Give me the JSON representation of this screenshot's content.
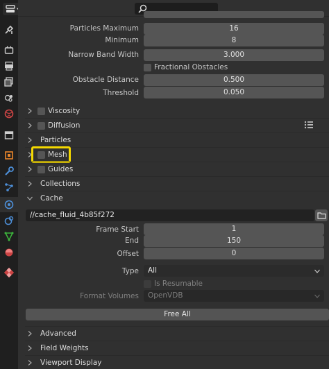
{
  "header": {
    "search_placeholder": ""
  },
  "fluid_settings": {
    "particles_maximum": {
      "label": "Particles Maximum",
      "value": "16"
    },
    "minimum": {
      "label": "Minimum",
      "value": "8"
    },
    "narrow_band_width": {
      "label": "Narrow Band Width",
      "value": "3.000"
    },
    "fractional_obstacles": {
      "label": "Fractional Obstacles"
    },
    "obstacle_distance": {
      "label": "Obstacle Distance",
      "value": "0.500"
    },
    "threshold": {
      "label": "Threshold",
      "value": "0.050"
    }
  },
  "panels": {
    "viscosity": "Viscosity",
    "diffusion": "Diffusion",
    "particles": "Particles",
    "mesh": "Mesh",
    "guides": "Guides",
    "collections": "Collections",
    "cache": "Cache",
    "advanced": "Advanced",
    "field_weights": "Field Weights",
    "viewport_display": "Viewport Display"
  },
  "cache": {
    "directory": "//cache_fluid_4b85f272",
    "frame_start": {
      "label": "Frame Start",
      "value": "1"
    },
    "end": {
      "label": "End",
      "value": "150"
    },
    "offset": {
      "label": "Offset",
      "value": "0"
    },
    "type": {
      "label": "Type",
      "value": "All"
    },
    "is_resumable": {
      "label": "Is Resumable"
    },
    "format_volumes": {
      "label": "Format Volumes",
      "value": "OpenVDB"
    },
    "free_all": "Free All"
  },
  "colors": {
    "highlight": "#f4d800",
    "active_tab": "#4d8fd8"
  },
  "icons": [
    "tool-icon",
    "render-icon",
    "output-icon",
    "view-layer-icon",
    "scene-icon",
    "world-icon",
    "collection-icon",
    "object-icon",
    "modifier-icon",
    "particles-icon",
    "physics-icon",
    "constraints-icon",
    "object-data-icon",
    "material-icon",
    "texture-icon"
  ]
}
